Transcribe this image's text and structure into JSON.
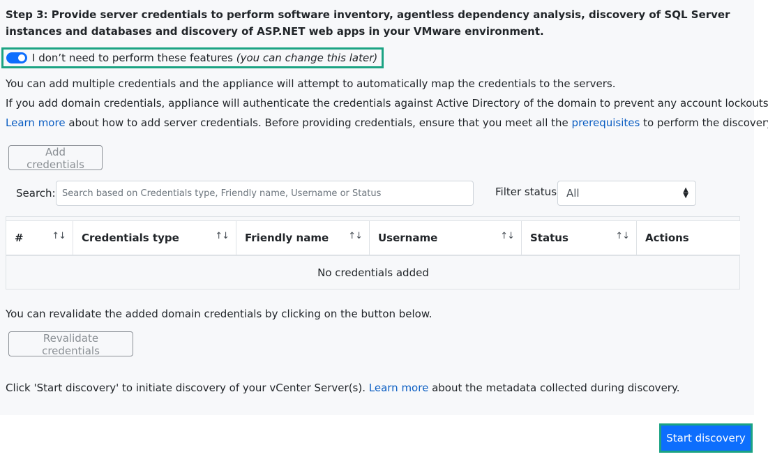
{
  "step": {
    "title": "Step 3: Provide server credentials to perform software inventory, agentless dependency analysis, discovery of SQL Server instances and databases and discovery of ASP.NET web apps in your VMware environment."
  },
  "toggle": {
    "label": "I don’t need to perform these features",
    "note": "(you can change this later)",
    "checked": true
  },
  "info": {
    "line1": "You can add multiple credentials and the appliance will attempt to automatically map the credentials to the servers.",
    "line2": "If you add domain credentials, appliance will authenticate the credentials against Active Directory of the domain to prevent any account lockouts.",
    "line3_link1": "Learn more",
    "line3_text1": " about how to add server credentials. Before providing credentials, ensure that you meet all the ",
    "line3_link2": "prerequisites",
    "line3_text2": " to perform the discovery."
  },
  "buttons": {
    "add_credentials": "Add credentials",
    "revalidate_credentials": "Revalidate credentials",
    "start_discovery": "Start discovery"
  },
  "search": {
    "label": "Search:",
    "placeholder": "Search based on Credentials type, Friendly name, Username or Status"
  },
  "filter": {
    "label": "Filter status",
    "selected": "All"
  },
  "table": {
    "columns": [
      "#",
      "Credentials type",
      "Friendly name",
      "Username",
      "Status",
      "Actions"
    ],
    "empty_message": "No credentials added"
  },
  "revalidate": {
    "text": "You can revalidate the added domain credentials by clicking on the button below."
  },
  "discovery": {
    "text1": "Click 'Start discovery' to initiate discovery of your vCenter Server(s). ",
    "link": "Learn more",
    "text2": " about the metadata collected during discovery."
  },
  "colors": {
    "accent": "#0d6efd",
    "highlight": "#1ba383",
    "link": "#0a5dc2"
  }
}
